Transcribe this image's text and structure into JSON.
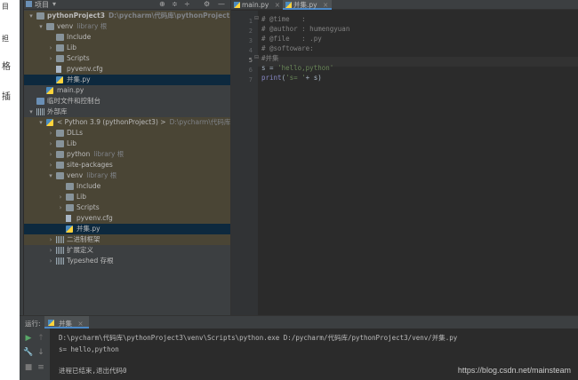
{
  "outer_strip": {
    "chars": [
      "目",
      "担",
      "格",
      "插"
    ]
  },
  "project_panel": {
    "title": "项目",
    "header_buttons": [
      "⊕",
      "≑",
      "÷",
      "⚙",
      "—"
    ],
    "tree": [
      {
        "label": "pythonProject3",
        "hint": "D:\\pycharm\\代码库\\pythonProject3",
        "indent": 0,
        "arrow": "▾",
        "icon": "folder",
        "style": "excluded",
        "bold": true
      },
      {
        "label": "venv",
        "hint": "library 根",
        "indent": 1,
        "arrow": "▾",
        "icon": "folder",
        "style": "excluded"
      },
      {
        "label": "Include",
        "hint": "",
        "indent": 2,
        "arrow": "",
        "icon": "folder",
        "style": "excluded"
      },
      {
        "label": "Lib",
        "hint": "",
        "indent": 2,
        "arrow": "›",
        "icon": "folder",
        "style": "excluded"
      },
      {
        "label": "Scripts",
        "hint": "",
        "indent": 2,
        "arrow": "›",
        "icon": "folder",
        "style": "excluded"
      },
      {
        "label": "pyvenv.cfg",
        "hint": "",
        "indent": 2,
        "arrow": "",
        "icon": "cfg",
        "style": "excluded"
      },
      {
        "label": "并集.py",
        "hint": "",
        "indent": 2,
        "arrow": "",
        "icon": "py",
        "style": "selected"
      },
      {
        "label": "main.py",
        "hint": "",
        "indent": 1,
        "arrow": "",
        "icon": "py",
        "style": ""
      },
      {
        "label": "临时文件和控制台",
        "hint": "",
        "indent": 0,
        "arrow": "",
        "icon": "folder-blue",
        "style": ""
      },
      {
        "label": "外部库",
        "hint": "",
        "indent": 0,
        "arrow": "▾",
        "icon": "lib",
        "style": ""
      },
      {
        "label": "< Python 3.9 (pythonProject3) >",
        "hint": "D:\\pycharm\\代码库\\pyth",
        "indent": 1,
        "arrow": "▾",
        "icon": "py",
        "style": "excluded"
      },
      {
        "label": "DLLs",
        "hint": "",
        "indent": 2,
        "arrow": "›",
        "icon": "folder",
        "style": "excluded"
      },
      {
        "label": "Lib",
        "hint": "",
        "indent": 2,
        "arrow": "›",
        "icon": "folder",
        "style": "excluded"
      },
      {
        "label": "python",
        "hint": "library 根",
        "indent": 2,
        "arrow": "›",
        "icon": "folder",
        "style": "excluded"
      },
      {
        "label": "site-packages",
        "hint": "",
        "indent": 2,
        "arrow": "›",
        "icon": "folder",
        "style": "excluded"
      },
      {
        "label": "venv",
        "hint": "library 根",
        "indent": 2,
        "arrow": "▾",
        "icon": "folder",
        "style": "excluded"
      },
      {
        "label": "Include",
        "hint": "",
        "indent": 3,
        "arrow": "",
        "icon": "folder",
        "style": "excluded"
      },
      {
        "label": "Lib",
        "hint": "",
        "indent": 3,
        "arrow": "›",
        "icon": "folder",
        "style": "excluded"
      },
      {
        "label": "Scripts",
        "hint": "",
        "indent": 3,
        "arrow": "›",
        "icon": "folder",
        "style": "excluded"
      },
      {
        "label": "pyvenv.cfg",
        "hint": "",
        "indent": 3,
        "arrow": "",
        "icon": "cfg",
        "style": "excluded"
      },
      {
        "label": "并集.py",
        "hint": "",
        "indent": 3,
        "arrow": "",
        "icon": "py",
        "style": "selected"
      },
      {
        "label": "二进制框架",
        "hint": "",
        "indent": 2,
        "arrow": "›",
        "icon": "lib",
        "style": "excluded"
      },
      {
        "label": "扩展定义",
        "hint": "",
        "indent": 2,
        "arrow": "›",
        "icon": "lib",
        "style": ""
      },
      {
        "label": "Typeshed 存根",
        "hint": "",
        "indent": 2,
        "arrow": "›",
        "icon": "lib",
        "style": ""
      }
    ]
  },
  "editor": {
    "tabs": [
      {
        "label": "main.py",
        "active": false
      },
      {
        "label": "并集.py",
        "active": true
      }
    ],
    "lines": [
      {
        "n": "1",
        "parts": [
          {
            "t": "# @time   :",
            "c": "comment"
          }
        ]
      },
      {
        "n": "2",
        "parts": [
          {
            "t": "# @author : humengyuan",
            "c": "comment"
          }
        ]
      },
      {
        "n": "3",
        "parts": [
          {
            "t": "# @file   : .py",
            "c": "comment"
          }
        ]
      },
      {
        "n": "4",
        "parts": [
          {
            "t": "# @softoware:",
            "c": "comment"
          }
        ]
      },
      {
        "n": "5",
        "parts": [
          {
            "t": "#并集",
            "c": "comment"
          }
        ]
      },
      {
        "n": "6",
        "parts": [
          {
            "t": "s = ",
            "c": "plain"
          },
          {
            "t": "'hello,python'",
            "c": "str"
          }
        ]
      },
      {
        "n": "7",
        "parts": [
          {
            "t": "print",
            "c": "kw"
          },
          {
            "t": "(",
            "c": "plain"
          },
          {
            "t": "'s= '",
            "c": "str"
          },
          {
            "t": "+ s)",
            "c": "plain"
          }
        ]
      }
    ],
    "current_line": 5
  },
  "run_panel": {
    "label": "运行:",
    "tab": "并集",
    "console": [
      "D:\\pycharm\\代码库\\pythonProject3\\venv\\Scripts\\python.exe D:/pycharm/代码库/pythonProject3/venv/并集.py",
      "s= hello,python",
      "",
      "进程已结束,退出代码0"
    ]
  },
  "watermark": "https://blog.csdn.net/mainsteam",
  "colors": {
    "accent": "#4a88c7",
    "excluded_bg": "#4a4535",
    "selected_bg": "#0d293e"
  }
}
